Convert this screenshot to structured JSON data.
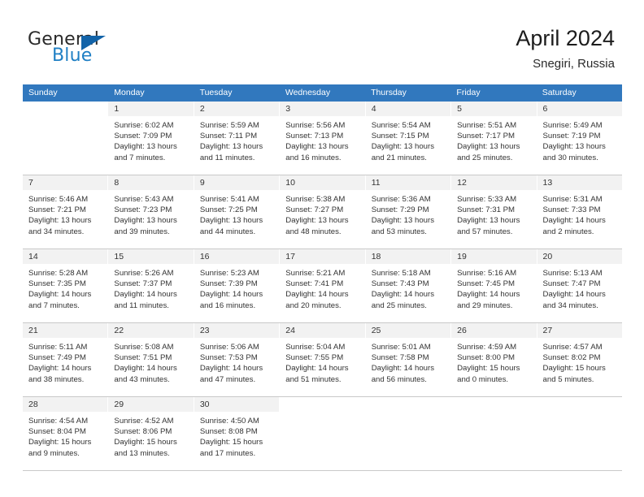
{
  "brand": {
    "name_part1": "General",
    "name_part2": "Blue",
    "logo_icon": "triangle-logo-icon",
    "accent_color": "#1f7fc4"
  },
  "header": {
    "title": "April 2024",
    "subtitle": "Snegiri, Russia"
  },
  "theme": {
    "header_row_bg": "#3178be",
    "header_row_text": "#ffffff",
    "daynum_bg": "#f2f2f2",
    "body_text": "#333333"
  },
  "weekdays": [
    "Sunday",
    "Monday",
    "Tuesday",
    "Wednesday",
    "Thursday",
    "Friday",
    "Saturday"
  ],
  "weeks": [
    [
      {
        "day": "",
        "lines": []
      },
      {
        "day": "1",
        "lines": [
          "Sunrise: 6:02 AM",
          "Sunset: 7:09 PM",
          "Daylight: 13 hours",
          "and 7 minutes."
        ]
      },
      {
        "day": "2",
        "lines": [
          "Sunrise: 5:59 AM",
          "Sunset: 7:11 PM",
          "Daylight: 13 hours",
          "and 11 minutes."
        ]
      },
      {
        "day": "3",
        "lines": [
          "Sunrise: 5:56 AM",
          "Sunset: 7:13 PM",
          "Daylight: 13 hours",
          "and 16 minutes."
        ]
      },
      {
        "day": "4",
        "lines": [
          "Sunrise: 5:54 AM",
          "Sunset: 7:15 PM",
          "Daylight: 13 hours",
          "and 21 minutes."
        ]
      },
      {
        "day": "5",
        "lines": [
          "Sunrise: 5:51 AM",
          "Sunset: 7:17 PM",
          "Daylight: 13 hours",
          "and 25 minutes."
        ]
      },
      {
        "day": "6",
        "lines": [
          "Sunrise: 5:49 AM",
          "Sunset: 7:19 PM",
          "Daylight: 13 hours",
          "and 30 minutes."
        ]
      }
    ],
    [
      {
        "day": "7",
        "lines": [
          "Sunrise: 5:46 AM",
          "Sunset: 7:21 PM",
          "Daylight: 13 hours",
          "and 34 minutes."
        ]
      },
      {
        "day": "8",
        "lines": [
          "Sunrise: 5:43 AM",
          "Sunset: 7:23 PM",
          "Daylight: 13 hours",
          "and 39 minutes."
        ]
      },
      {
        "day": "9",
        "lines": [
          "Sunrise: 5:41 AM",
          "Sunset: 7:25 PM",
          "Daylight: 13 hours",
          "and 44 minutes."
        ]
      },
      {
        "day": "10",
        "lines": [
          "Sunrise: 5:38 AM",
          "Sunset: 7:27 PM",
          "Daylight: 13 hours",
          "and 48 minutes."
        ]
      },
      {
        "day": "11",
        "lines": [
          "Sunrise: 5:36 AM",
          "Sunset: 7:29 PM",
          "Daylight: 13 hours",
          "and 53 minutes."
        ]
      },
      {
        "day": "12",
        "lines": [
          "Sunrise: 5:33 AM",
          "Sunset: 7:31 PM",
          "Daylight: 13 hours",
          "and 57 minutes."
        ]
      },
      {
        "day": "13",
        "lines": [
          "Sunrise: 5:31 AM",
          "Sunset: 7:33 PM",
          "Daylight: 14 hours",
          "and 2 minutes."
        ]
      }
    ],
    [
      {
        "day": "14",
        "lines": [
          "Sunrise: 5:28 AM",
          "Sunset: 7:35 PM",
          "Daylight: 14 hours",
          "and 7 minutes."
        ]
      },
      {
        "day": "15",
        "lines": [
          "Sunrise: 5:26 AM",
          "Sunset: 7:37 PM",
          "Daylight: 14 hours",
          "and 11 minutes."
        ]
      },
      {
        "day": "16",
        "lines": [
          "Sunrise: 5:23 AM",
          "Sunset: 7:39 PM",
          "Daylight: 14 hours",
          "and 16 minutes."
        ]
      },
      {
        "day": "17",
        "lines": [
          "Sunrise: 5:21 AM",
          "Sunset: 7:41 PM",
          "Daylight: 14 hours",
          "and 20 minutes."
        ]
      },
      {
        "day": "18",
        "lines": [
          "Sunrise: 5:18 AM",
          "Sunset: 7:43 PM",
          "Daylight: 14 hours",
          "and 25 minutes."
        ]
      },
      {
        "day": "19",
        "lines": [
          "Sunrise: 5:16 AM",
          "Sunset: 7:45 PM",
          "Daylight: 14 hours",
          "and 29 minutes."
        ]
      },
      {
        "day": "20",
        "lines": [
          "Sunrise: 5:13 AM",
          "Sunset: 7:47 PM",
          "Daylight: 14 hours",
          "and 34 minutes."
        ]
      }
    ],
    [
      {
        "day": "21",
        "lines": [
          "Sunrise: 5:11 AM",
          "Sunset: 7:49 PM",
          "Daylight: 14 hours",
          "and 38 minutes."
        ]
      },
      {
        "day": "22",
        "lines": [
          "Sunrise: 5:08 AM",
          "Sunset: 7:51 PM",
          "Daylight: 14 hours",
          "and 43 minutes."
        ]
      },
      {
        "day": "23",
        "lines": [
          "Sunrise: 5:06 AM",
          "Sunset: 7:53 PM",
          "Daylight: 14 hours",
          "and 47 minutes."
        ]
      },
      {
        "day": "24",
        "lines": [
          "Sunrise: 5:04 AM",
          "Sunset: 7:55 PM",
          "Daylight: 14 hours",
          "and 51 minutes."
        ]
      },
      {
        "day": "25",
        "lines": [
          "Sunrise: 5:01 AM",
          "Sunset: 7:58 PM",
          "Daylight: 14 hours",
          "and 56 minutes."
        ]
      },
      {
        "day": "26",
        "lines": [
          "Sunrise: 4:59 AM",
          "Sunset: 8:00 PM",
          "Daylight: 15 hours",
          "and 0 minutes."
        ]
      },
      {
        "day": "27",
        "lines": [
          "Sunrise: 4:57 AM",
          "Sunset: 8:02 PM",
          "Daylight: 15 hours",
          "and 5 minutes."
        ]
      }
    ],
    [
      {
        "day": "28",
        "lines": [
          "Sunrise: 4:54 AM",
          "Sunset: 8:04 PM",
          "Daylight: 15 hours",
          "and 9 minutes."
        ]
      },
      {
        "day": "29",
        "lines": [
          "Sunrise: 4:52 AM",
          "Sunset: 8:06 PM",
          "Daylight: 15 hours",
          "and 13 minutes."
        ]
      },
      {
        "day": "30",
        "lines": [
          "Sunrise: 4:50 AM",
          "Sunset: 8:08 PM",
          "Daylight: 15 hours",
          "and 17 minutes."
        ]
      },
      {
        "day": "",
        "lines": []
      },
      {
        "day": "",
        "lines": []
      },
      {
        "day": "",
        "lines": []
      },
      {
        "day": "",
        "lines": []
      }
    ]
  ]
}
